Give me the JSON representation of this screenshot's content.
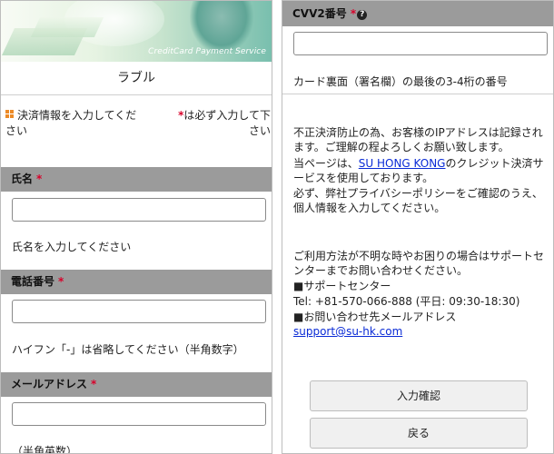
{
  "left_panel": {
    "banner_text": "CreditCard Payment Service",
    "title": "ラブル",
    "info_left": "決済情報を入力してください",
    "info_right_mark": "*",
    "info_right": "は必ず入力して下さい",
    "fields": [
      {
        "label": "氏名",
        "required_mark": "*",
        "value": "",
        "hint": "氏名を入力してください"
      },
      {
        "label": "電話番号",
        "required_mark": "*",
        "value": "",
        "hint": "ハイフン「-」は省略してください（半角数字）"
      },
      {
        "label": "メールアドレス",
        "required_mark": "*",
        "value": "",
        "hint": "（半角英数）"
      }
    ]
  },
  "right_panel": {
    "cvv_label": "CVV2番号",
    "cvv_required_mark": "*",
    "help_icon_glyph": "?",
    "cvv_value": "",
    "cvv_hint": "カード裏面（署名欄）の最後の3-4桁の番号",
    "notice_line1": "不正決済防止の為、お客様のIPアドレスは記録されます。ご理解の程よろしくお願い致します。",
    "notice_line2_prefix": "当ページは、",
    "notice_company": "SU HONG KONG",
    "notice_line2_suffix": "のクレジット決済サービスを使用しております。",
    "notice_line3": "必ず、弊社プライバシーポリシーをご確認のうえ、個人情報を入力してください。",
    "support_intro": "ご利用方法が不明な時やお困りの場合はサポートセンターまでお問い合わせください。",
    "support_center_label": "■サポートセンター",
    "support_tel": "Tel: +81-570-066-888 (平日: 09:30-18:30)",
    "support_email_label": "■お問い合わせ先メールアドレス",
    "support_email": "support@su-hk.com",
    "confirm_button": "入力確認",
    "back_button": "戻る"
  },
  "colors": {
    "section_header": "#9b9b9b",
    "required": "#d8002a",
    "link": "#0a2bd6",
    "info_icon": "#ec8a26"
  }
}
